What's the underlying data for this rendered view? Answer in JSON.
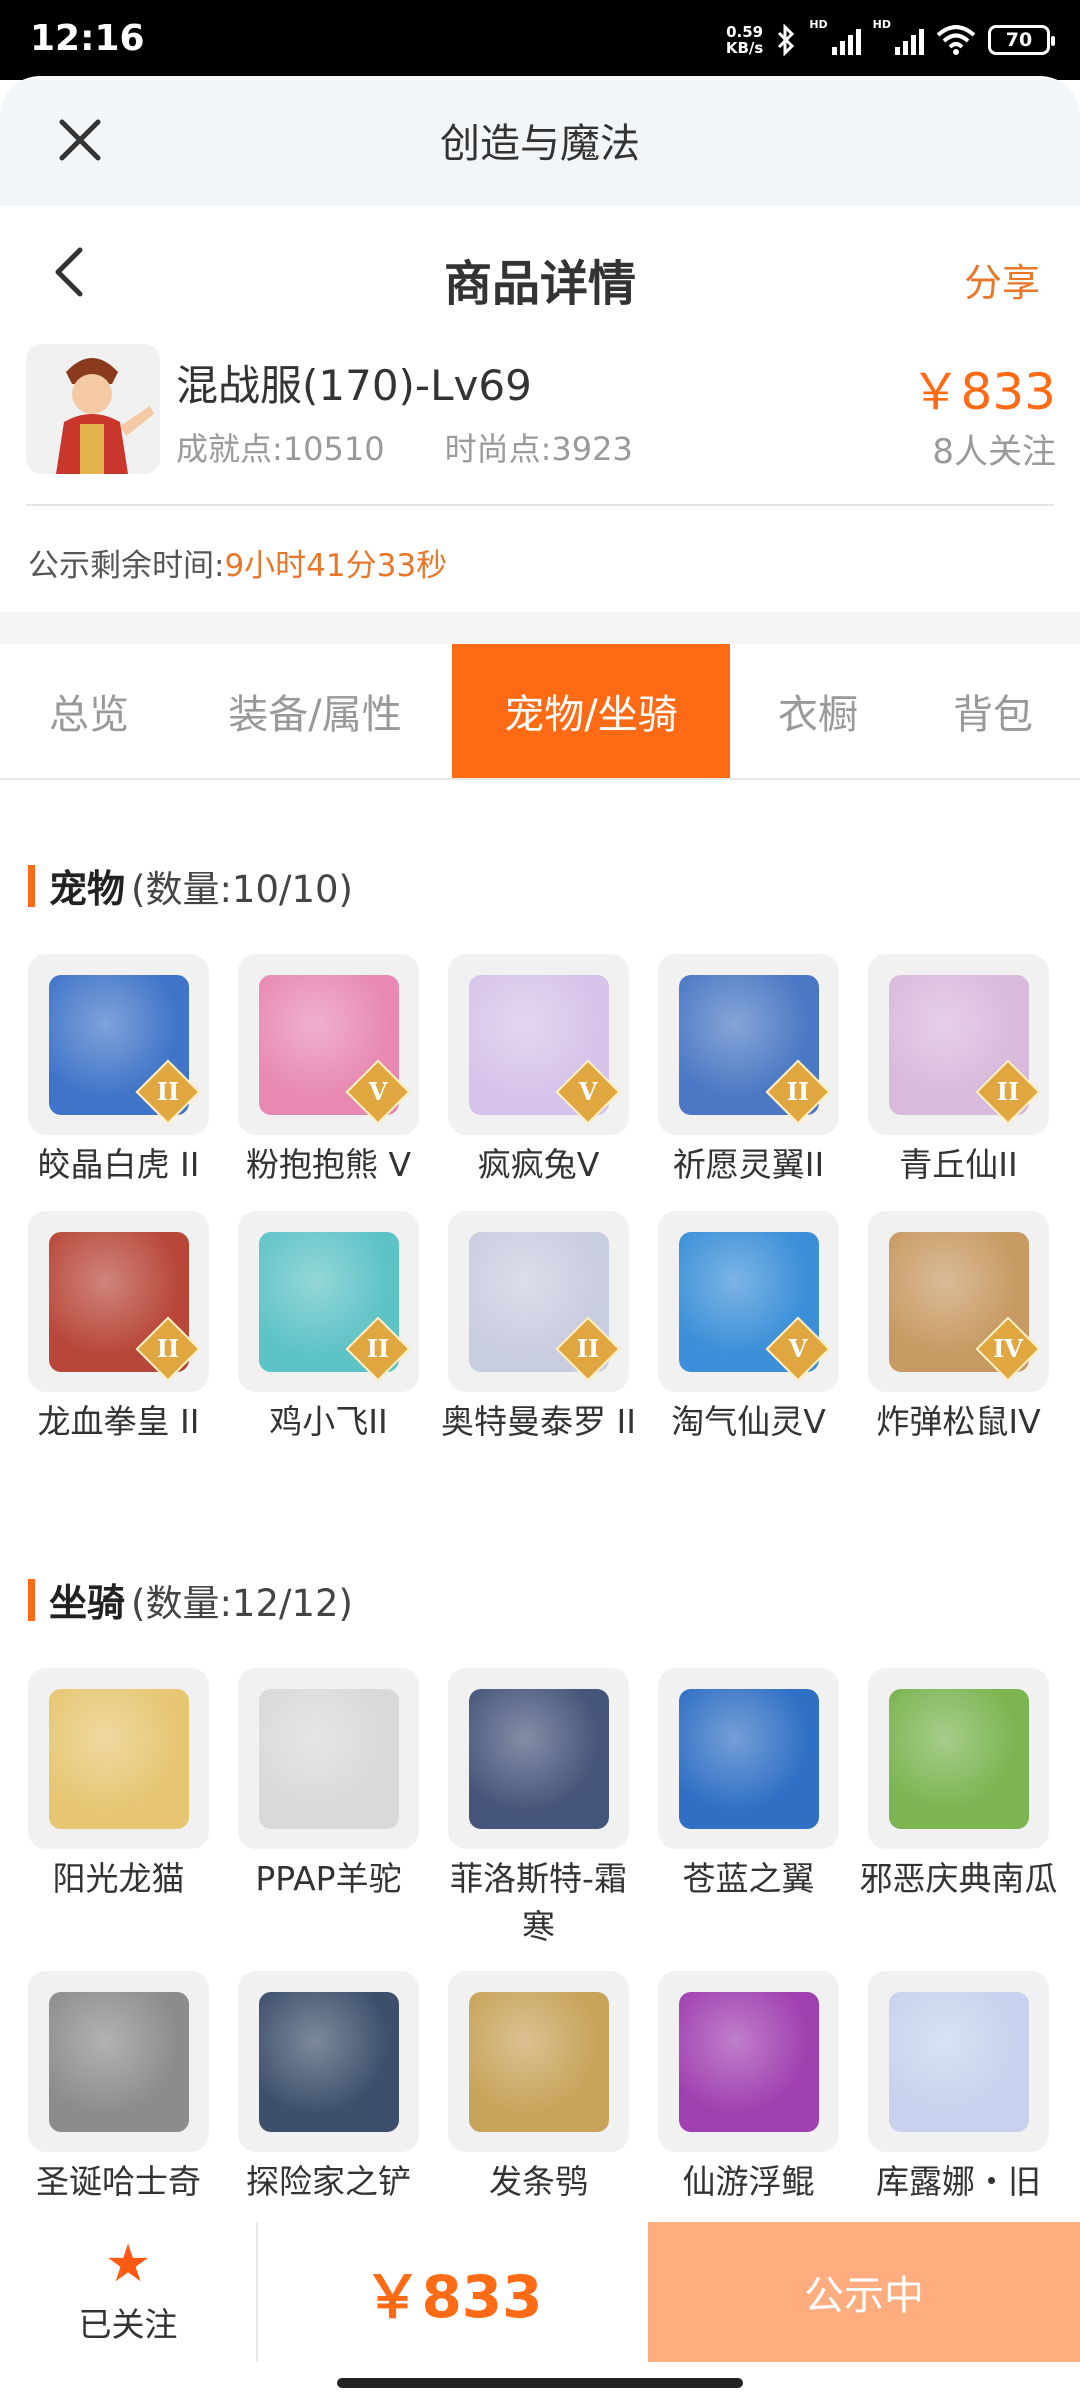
{
  "status_bar": {
    "time": "12:16",
    "net_speed_value": "0.59",
    "net_speed_unit": "KB/s",
    "hd1": "HD",
    "hd2": "HD",
    "battery": "70"
  },
  "app_header": {
    "title": "创造与魔法"
  },
  "nav": {
    "title": "商品详情",
    "share": "分享"
  },
  "product": {
    "name": "混战服(170)-Lv69",
    "achievement": "成就点:10510",
    "fashion": "时尚点:3923",
    "price": "￥833",
    "followers": "8人关注"
  },
  "notice": {
    "label": "公示剩余时间:",
    "time": "9小时41分33秒"
  },
  "tabs": [
    {
      "label": "总览"
    },
    {
      "label": "装备/属性"
    },
    {
      "label": "宠物/坐骑"
    },
    {
      "label": "衣橱"
    },
    {
      "label": "背包"
    }
  ],
  "pets": {
    "title": "宠物",
    "count": "(数量:10/10)",
    "items": [
      {
        "label": "皎晶白虎 II",
        "grade": "II",
        "color": "#3f74c8"
      },
      {
        "label": "粉抱抱熊 V",
        "grade": "V",
        "color": "#e889b4"
      },
      {
        "label": "疯疯兔V",
        "grade": "V",
        "color": "#d6c3ea"
      },
      {
        "label": "祈愿灵翼II",
        "grade": "II",
        "color": "#4a78c4"
      },
      {
        "label": "青丘仙II",
        "grade": "II",
        "color": "#d9b9dc"
      },
      {
        "label": "龙血拳皇 II",
        "grade": "II",
        "color": "#b8473a"
      },
      {
        "label": "鸡小飞II",
        "grade": "II",
        "color": "#5ec3c6"
      },
      {
        "label": "奥特曼泰罗 II",
        "grade": "II",
        "color": "#c9cde0"
      },
      {
        "label": "淘气仙灵V",
        "grade": "V",
        "color": "#3a8fd8"
      },
      {
        "label": "炸弹松鼠IV",
        "grade": "IV",
        "color": "#c89a63"
      }
    ]
  },
  "mounts": {
    "title": "坐骑",
    "count": "(数量:12/12)",
    "items": [
      {
        "label": "阳光龙猫",
        "color": "#e6c672"
      },
      {
        "label": "PPAP羊驼",
        "color": "#d9d9d9"
      },
      {
        "label": "菲洛斯特-霜寒",
        "color": "#46557a"
      },
      {
        "label": "苍蓝之翼",
        "color": "#2f6fc4"
      },
      {
        "label": "邪恶庆典南瓜",
        "color": "#7bb450"
      },
      {
        "label": "圣诞哈士奇",
        "color": "#8c8c8c"
      },
      {
        "label": "探险家之铲",
        "color": "#3c4f6b"
      },
      {
        "label": "发条鸮",
        "color": "#c8a35a"
      },
      {
        "label": "仙游浮鲲",
        "color": "#a03fb0"
      },
      {
        "label": "库露娜・旧",
        "color": "#c7d2ee"
      }
    ]
  },
  "bottom": {
    "followed": "已关注",
    "price": "￥833",
    "status": "公示中"
  }
}
